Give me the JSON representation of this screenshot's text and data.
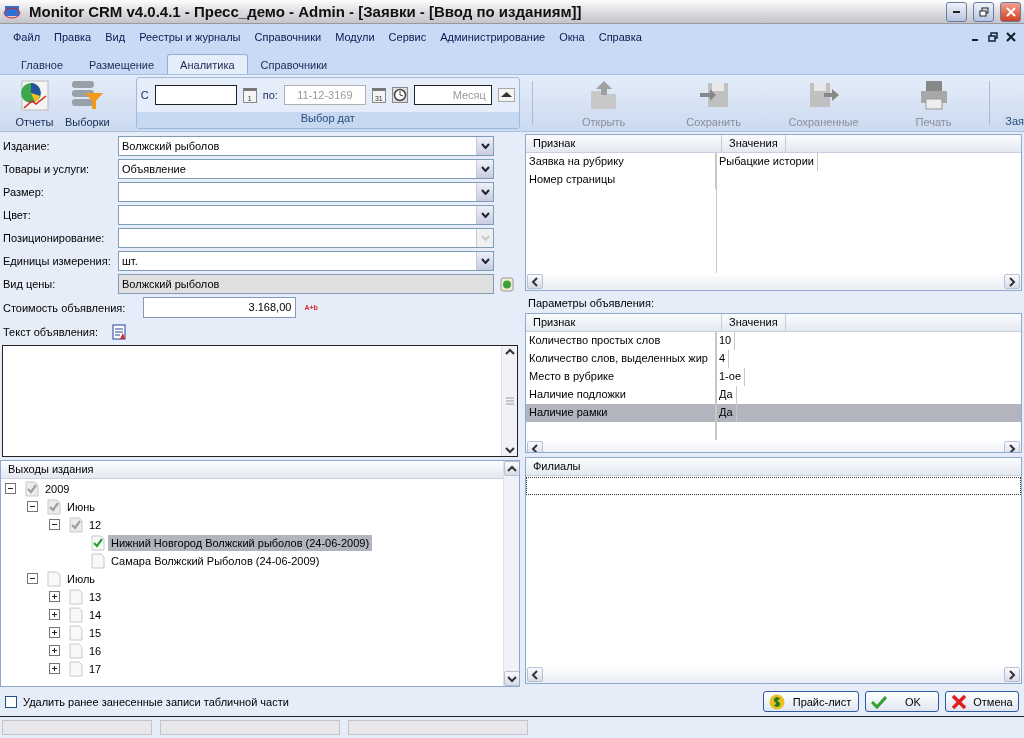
{
  "window": {
    "title": "Monitor CRM v4.0.4.1 - Пресс_демо - Admin - [Заявки - [Ввод по изданиям]]"
  },
  "menu": [
    {
      "label": "Файл"
    },
    {
      "label": "Правка"
    },
    {
      "label": "Вид"
    },
    {
      "label": "Реестры и журналы"
    },
    {
      "label": "Справочники"
    },
    {
      "label": "Модули"
    },
    {
      "label": "Сервис"
    },
    {
      "label": "Администрирование"
    },
    {
      "label": "Окна"
    },
    {
      "label": "Справка"
    }
  ],
  "tabs": [
    {
      "label": "Главное",
      "selected": false
    },
    {
      "label": "Размещение",
      "selected": false
    },
    {
      "label": "Аналитика",
      "selected": true
    },
    {
      "label": "Справочники",
      "selected": false
    }
  ],
  "ribbon": {
    "big_buttons": [
      {
        "label": "Отчеты",
        "kind": "reports"
      },
      {
        "label": "Выборки",
        "kind": "filter"
      }
    ],
    "date_group": {
      "from_label": "С",
      "from_icon": "1",
      "to_label": "по:",
      "to_value": "11-12-3169",
      "to_disabled": true,
      "to_icon": "31",
      "period_placeholder": "Месяц",
      "caption": "Выбор дат"
    },
    "actions": [
      {
        "label": "Открыть",
        "kind": "open",
        "disabled": true
      },
      {
        "label": "Сохранить",
        "kind": "save",
        "disabled": true
      },
      {
        "label": "Сохраненные",
        "kind": "saved",
        "disabled": true
      },
      {
        "label": "Печать",
        "kind": "print",
        "disabled": true
      }
    ],
    "cut_label": "Зая"
  },
  "form": {
    "fields": [
      {
        "label": "Издание:",
        "kind": "select",
        "value": "Волжский рыболов",
        "disabled": false
      },
      {
        "label": "Товары и услуги:",
        "kind": "select",
        "value": "Объявление",
        "disabled": false
      },
      {
        "label": "Размер:",
        "kind": "select",
        "disabled": false
      },
      {
        "label": "Цвет:",
        "kind": "select",
        "disabled": false
      },
      {
        "label": "Позиционирование:",
        "kind": "select",
        "disabled": true
      },
      {
        "label": "Единицы измерения:",
        "kind": "select",
        "value": "шт.",
        "disabled": false
      },
      {
        "label": "Вид цены:",
        "kind": "readonly",
        "value": "Волжский рыболов"
      }
    ],
    "cost": {
      "label": "Стоимость объявления:",
      "value": "3.168,00",
      "formula": "A+b"
    },
    "text_label": "Текст объявления:"
  },
  "tree": {
    "title": "Выходы издания",
    "nodes": [
      {
        "label": "2009",
        "checked": true,
        "partial": true,
        "expanded": true,
        "children": [
          {
            "label": "Июнь",
            "checked": true,
            "partial": true,
            "expanded": true,
            "children": [
              {
                "label": "12",
                "checked": true,
                "partial": true,
                "expanded": true,
                "children": [
                  {
                    "label": "Нижний Новгород Волжский рыболов (24-06-2009)",
                    "checked": true,
                    "partial": false,
                    "selected": true
                  },
                  {
                    "label": "Самара Волжский Рыболов (24-06-2009)",
                    "checked": false,
                    "partial": false,
                    "selected": false
                  }
                ]
              }
            ]
          },
          {
            "label": "Июль",
            "checked": false,
            "partial": false,
            "expanded": true,
            "children": [
              {
                "label": "13",
                "checked": false,
                "partial": false,
                "expanded": false
              },
              {
                "label": "14",
                "checked": false,
                "partial": false,
                "expanded": false
              },
              {
                "label": "15",
                "checked": false,
                "partial": false,
                "expanded": false
              },
              {
                "label": "16",
                "checked": false,
                "partial": false,
                "expanded": false
              },
              {
                "label": "17",
                "checked": false,
                "partial": false,
                "expanded": false
              }
            ]
          }
        ]
      }
    ]
  },
  "grid1": {
    "columns": [
      "Признак",
      "Значения"
    ],
    "rows": [
      {
        "cells": [
          "Заявка на рубрику",
          "Рыбацкие истории"
        ],
        "selected": false
      },
      {
        "cells": [
          "Номер страницы"
        ],
        "selected": false
      }
    ]
  },
  "params_label": "Параметры объявления:",
  "grid2": {
    "columns": [
      "Признак",
      "Значения"
    ],
    "rows": [
      {
        "cells": [
          "Количество простых слов",
          "10"
        ],
        "selected": false
      },
      {
        "cells": [
          "Количество слов, выделенных жир",
          "4"
        ],
        "selected": false
      },
      {
        "cells": [
          "Место в рубрике",
          "1-ое"
        ],
        "selected": false
      },
      {
        "cells": [
          "Наличие подложки",
          "Да"
        ],
        "selected": false
      },
      {
        "cells": [
          "Наличие рамки",
          "Да"
        ],
        "selected": true
      }
    ]
  },
  "branches": {
    "title": "Филиалы"
  },
  "footer": {
    "checkbox": {
      "label": "Удалить ранее занесенные записи табличной части",
      "checked": false
    },
    "buttons": [
      {
        "label": "Прайс-лист",
        "kind": "price"
      },
      {
        "label": "OK",
        "kind": "ok"
      },
      {
        "label": "Отмена",
        "kind": "cancel"
      }
    ]
  }
}
